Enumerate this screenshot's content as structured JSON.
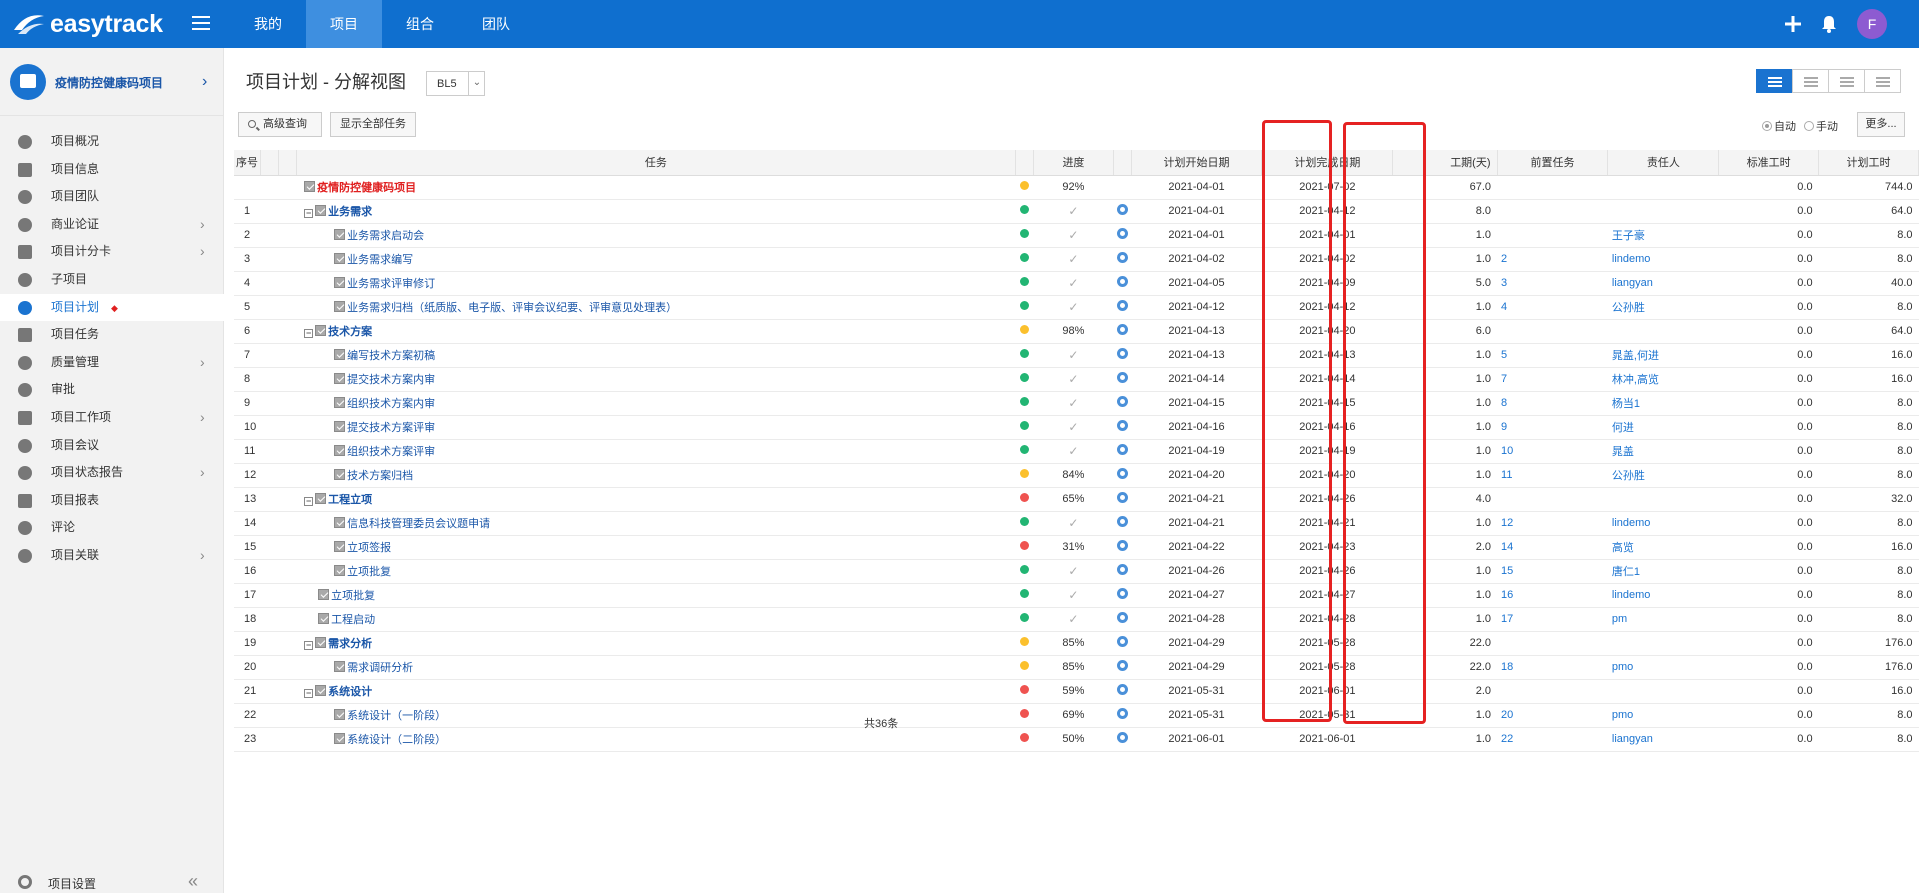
{
  "header": {
    "logo_text": "easytrack",
    "nav": [
      {
        "label": "我的",
        "active": false
      },
      {
        "label": "项目",
        "active": true
      },
      {
        "label": "组合",
        "active": false
      },
      {
        "label": "团队",
        "active": false
      }
    ],
    "user_initial": "F"
  },
  "sidebar": {
    "project_name": "疫情防控健康码项目",
    "items": [
      {
        "label": "项目概况",
        "chevron": false
      },
      {
        "label": "项目信息",
        "chevron": false
      },
      {
        "label": "项目团队",
        "chevron": false
      },
      {
        "label": "商业论证",
        "chevron": true
      },
      {
        "label": "项目计分卡",
        "chevron": true
      },
      {
        "label": "子项目",
        "chevron": false
      },
      {
        "label": "项目计划",
        "chevron": false,
        "active": true
      },
      {
        "label": "项目任务",
        "chevron": false
      },
      {
        "label": "质量管理",
        "chevron": true
      },
      {
        "label": "审批",
        "chevron": false
      },
      {
        "label": "项目工作项",
        "chevron": true
      },
      {
        "label": "项目会议",
        "chevron": false
      },
      {
        "label": "项目状态报告",
        "chevron": true
      },
      {
        "label": "项目报表",
        "chevron": false
      },
      {
        "label": "评论",
        "chevron": false
      },
      {
        "label": "项目关联",
        "chevron": true
      }
    ],
    "footer_label": "项目设置"
  },
  "main": {
    "title": "项目计划 - 分解视图",
    "baseline": "BL5",
    "advanced_query": "高级查询",
    "show_all": "显示全部任务",
    "mode_auto": "自动",
    "mode_manual": "手动",
    "more": "更多...",
    "pager": "共36条"
  },
  "colors": {
    "green": "#22b573",
    "yellow": "#fbc02d",
    "red": "#ef5350",
    "accent": "#0f6fcf"
  },
  "table": {
    "columns": [
      "序号",
      "任务",
      "进度",
      "计划开始日期",
      "计划完成日期",
      "工期(天)",
      "前置任务",
      "责任人",
      "标准工时",
      "计划工时"
    ],
    "rows": [
      {
        "seq": "",
        "name": "疫情防控健康码项目",
        "level": 0,
        "group": false,
        "status": "yellow",
        "progress": "92%",
        "start": "2021-04-01",
        "end": "2021-07-02",
        "duration": "67.0",
        "pred": "",
        "owner": "",
        "std": "0.0",
        "plan": "744.0"
      },
      {
        "seq": "1",
        "name": "业务需求",
        "level": 1,
        "group": true,
        "status": "green",
        "progress": "✓",
        "start": "2021-04-01",
        "end": "2021-04-12",
        "duration": "8.0",
        "pred": "",
        "owner": "",
        "std": "0.0",
        "plan": "64.0"
      },
      {
        "seq": "2",
        "name": "业务需求启动会",
        "level": 2,
        "group": false,
        "status": "green",
        "progress": "✓",
        "start": "2021-04-01",
        "end": "2021-04-01",
        "duration": "1.0",
        "pred": "",
        "owner": "王子豪",
        "std": "0.0",
        "plan": "8.0"
      },
      {
        "seq": "3",
        "name": "业务需求编写",
        "level": 2,
        "group": false,
        "status": "green",
        "progress": "✓",
        "start": "2021-04-02",
        "end": "2021-04-02",
        "duration": "1.0",
        "pred": "2",
        "owner": "lindemo",
        "std": "0.0",
        "plan": "8.0"
      },
      {
        "seq": "4",
        "name": "业务需求评审修订",
        "level": 2,
        "group": false,
        "status": "green",
        "progress": "✓",
        "start": "2021-04-05",
        "end": "2021-04-09",
        "duration": "5.0",
        "pred": "3",
        "owner": "liangyan",
        "std": "0.0",
        "plan": "40.0"
      },
      {
        "seq": "5",
        "name": "业务需求归档（纸质版、电子版、评审会议纪要、评审意见处理表）",
        "level": 2,
        "group": false,
        "status": "green",
        "progress": "✓",
        "start": "2021-04-12",
        "end": "2021-04-12",
        "duration": "1.0",
        "pred": "4",
        "owner": "公孙胜",
        "std": "0.0",
        "plan": "8.0"
      },
      {
        "seq": "6",
        "name": "技术方案",
        "level": 1,
        "group": true,
        "status": "yellow",
        "progress": "98%",
        "start": "2021-04-13",
        "end": "2021-04-20",
        "duration": "6.0",
        "pred": "",
        "owner": "",
        "std": "0.0",
        "plan": "64.0"
      },
      {
        "seq": "7",
        "name": "编写技术方案初稿",
        "level": 2,
        "group": false,
        "status": "green",
        "progress": "✓",
        "start": "2021-04-13",
        "end": "2021-04-13",
        "duration": "1.0",
        "pred": "5",
        "owner": "晁盖,何进",
        "std": "0.0",
        "plan": "16.0"
      },
      {
        "seq": "8",
        "name": "提交技术方案内审",
        "level": 2,
        "group": false,
        "status": "green",
        "progress": "✓",
        "start": "2021-04-14",
        "end": "2021-04-14",
        "duration": "1.0",
        "pred": "7",
        "owner": "林冲,高览",
        "std": "0.0",
        "plan": "16.0"
      },
      {
        "seq": "9",
        "name": "组织技术方案内审",
        "level": 2,
        "group": false,
        "status": "green",
        "progress": "✓",
        "start": "2021-04-15",
        "end": "2021-04-15",
        "duration": "1.0",
        "pred": "8",
        "owner": "杨当1",
        "std": "0.0",
        "plan": "8.0"
      },
      {
        "seq": "10",
        "name": "提交技术方案评审",
        "level": 2,
        "group": false,
        "status": "green",
        "progress": "✓",
        "start": "2021-04-16",
        "end": "2021-04-16",
        "duration": "1.0",
        "pred": "9",
        "owner": "何进",
        "std": "0.0",
        "plan": "8.0"
      },
      {
        "seq": "11",
        "name": "组织技术方案评审",
        "level": 2,
        "group": false,
        "status": "green",
        "progress": "✓",
        "start": "2021-04-19",
        "end": "2021-04-19",
        "duration": "1.0",
        "pred": "10",
        "owner": "晁盖",
        "std": "0.0",
        "plan": "8.0"
      },
      {
        "seq": "12",
        "name": "技术方案归档",
        "level": 2,
        "group": false,
        "status": "yellow",
        "progress": "84%",
        "start": "2021-04-20",
        "end": "2021-04-20",
        "duration": "1.0",
        "pred": "11",
        "owner": "公孙胜",
        "std": "0.0",
        "plan": "8.0"
      },
      {
        "seq": "13",
        "name": "工程立项",
        "level": 1,
        "group": true,
        "status": "red",
        "progress": "65%",
        "start": "2021-04-21",
        "end": "2021-04-26",
        "duration": "4.0",
        "pred": "",
        "owner": "",
        "std": "0.0",
        "plan": "32.0"
      },
      {
        "seq": "14",
        "name": "信息科技管理委员会议题申请",
        "level": 2,
        "group": false,
        "status": "green",
        "progress": "✓",
        "start": "2021-04-21",
        "end": "2021-04-21",
        "duration": "1.0",
        "pred": "12",
        "owner": "lindemo",
        "std": "0.0",
        "plan": "8.0"
      },
      {
        "seq": "15",
        "name": "立项签报",
        "level": 2,
        "group": false,
        "status": "red",
        "progress": "31%",
        "start": "2021-04-22",
        "end": "2021-04-23",
        "duration": "2.0",
        "pred": "14",
        "owner": "高览",
        "std": "0.0",
        "plan": "16.0"
      },
      {
        "seq": "16",
        "name": "立项批复",
        "level": 2,
        "group": false,
        "status": "green",
        "progress": "✓",
        "start": "2021-04-26",
        "end": "2021-04-26",
        "duration": "1.0",
        "pred": "15",
        "owner": "唐仁1",
        "std": "0.0",
        "plan": "8.0"
      },
      {
        "seq": "17",
        "name": "立项批复",
        "level": 1,
        "group": false,
        "status": "green",
        "progress": "✓",
        "start": "2021-04-27",
        "end": "2021-04-27",
        "duration": "1.0",
        "pred": "16",
        "owner": "lindemo",
        "std": "0.0",
        "plan": "8.0"
      },
      {
        "seq": "18",
        "name": "工程启动",
        "level": 1,
        "group": false,
        "status": "green",
        "progress": "✓",
        "start": "2021-04-28",
        "end": "2021-04-28",
        "duration": "1.0",
        "pred": "17",
        "owner": "pm",
        "std": "0.0",
        "plan": "8.0"
      },
      {
        "seq": "19",
        "name": "需求分析",
        "level": 1,
        "group": true,
        "status": "yellow",
        "progress": "85%",
        "start": "2021-04-29",
        "end": "2021-05-28",
        "duration": "22.0",
        "pred": "",
        "owner": "",
        "std": "0.0",
        "plan": "176.0"
      },
      {
        "seq": "20",
        "name": "需求调研分析",
        "level": 2,
        "group": false,
        "status": "yellow",
        "progress": "85%",
        "start": "2021-04-29",
        "end": "2021-05-28",
        "duration": "22.0",
        "pred": "18",
        "owner": "pmo",
        "std": "0.0",
        "plan": "176.0"
      },
      {
        "seq": "21",
        "name": "系统设计",
        "level": 1,
        "group": true,
        "status": "red",
        "progress": "59%",
        "start": "2021-05-31",
        "end": "2021-06-01",
        "duration": "2.0",
        "pred": "",
        "owner": "",
        "std": "0.0",
        "plan": "16.0"
      },
      {
        "seq": "22",
        "name": "系统设计（一阶段）",
        "level": 2,
        "group": false,
        "status": "red",
        "progress": "69%",
        "start": "2021-05-31",
        "end": "2021-05-31",
        "duration": "1.0",
        "pred": "20",
        "owner": "pmo",
        "std": "0.0",
        "plan": "8.0"
      },
      {
        "seq": "23",
        "name": "系统设计（二阶段）",
        "level": 2,
        "group": false,
        "status": "red",
        "progress": "50%",
        "start": "2021-06-01",
        "end": "2021-06-01",
        "duration": "1.0",
        "pred": "22",
        "owner": "liangyan",
        "std": "0.0",
        "plan": "8.0"
      }
    ]
  }
}
